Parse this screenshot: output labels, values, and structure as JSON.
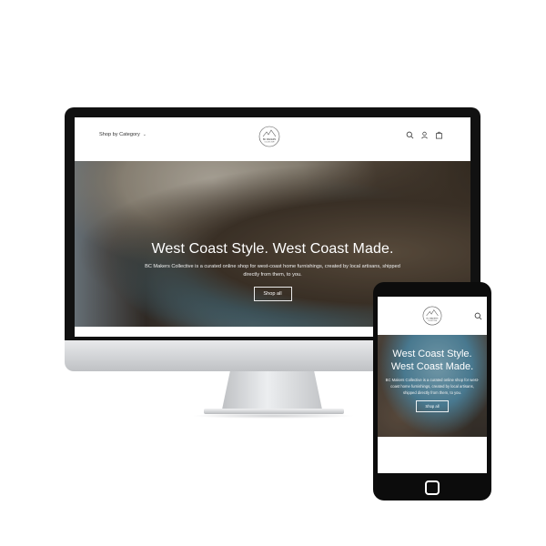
{
  "desktop": {
    "header": {
      "shop_by_category": "Shop by Category",
      "logo_text": "BC MAKERS",
      "logo_subtext": "COLLECTIVE"
    },
    "hero": {
      "title": "West Coast Style. West Coast Made.",
      "description": "BC Makers Collective is a curated online shop for west-coast home furnishings, created by local artisans, shipped directly from them, to you.",
      "button": "Shop all"
    }
  },
  "mobile": {
    "header": {
      "logo_text": "BC MAKERS",
      "logo_subtext": "COLLECTIVE"
    },
    "hero": {
      "title": "West Coast Style. West Coast Made.",
      "description": "BC Makers Collective is a curated online shop for west-coast home furnishings, created by local artisans, shipped directly from them, to you.",
      "button": "Shop all"
    }
  },
  "colors": {
    "bezel": "#111111",
    "stand": "#d0d2d5",
    "hero_text": "#ffffff"
  }
}
